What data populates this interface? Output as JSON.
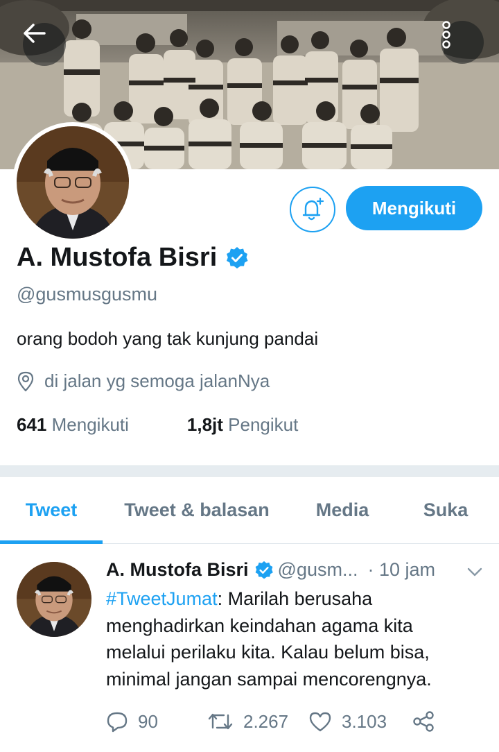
{
  "nav": {
    "back_icon": "arrow-left-icon",
    "more_icon": "vertical-dots-icon"
  },
  "profile": {
    "display_name": "A. Mustofa Bisri",
    "handle": "@gusmusgusmu",
    "bio": "orang bodoh yang tak kunjung pandai",
    "location": "di jalan yg semoga jalanNya",
    "following_count": "641",
    "following_label": "Mengikuti",
    "followers_count": "1,8jt",
    "followers_label": "Pengikut",
    "follow_button_label": "Mengikuti",
    "verified": true
  },
  "tabs": [
    {
      "label": "Tweet",
      "active": true
    },
    {
      "label": "Tweet & balasan",
      "active": false
    },
    {
      "label": "Media",
      "active": false
    },
    {
      "label": "Suka",
      "active": false
    }
  ],
  "tweet": {
    "author_name": "A. Mustofa Bisri",
    "author_handle": "@gusm...",
    "time": "· 10 jam",
    "hashtag": "#TweetJumat",
    "text": ": Marilah berusaha menghadirkan keindahan agama kita melalui perilaku kita. Kalau belum bisa, minimal jangan sampai mencorengnya.",
    "replies": "90",
    "retweets": "2.267",
    "likes": "3.103"
  },
  "colors": {
    "accent": "#1da1f2",
    "text_primary": "#14171a",
    "text_secondary": "#657786"
  }
}
